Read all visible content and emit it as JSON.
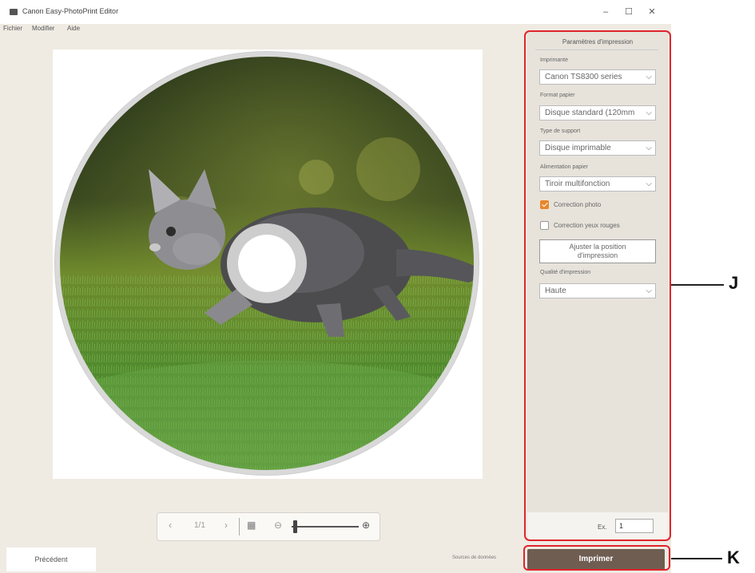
{
  "window": {
    "title": "Canon Easy-PhotoPrint Editor",
    "controls": {
      "minimize": "–",
      "maximize": "☐",
      "close": "✕"
    }
  },
  "menu": [
    "Fichier",
    "Modifier",
    "Aide"
  ],
  "panel": {
    "title": "Paramètres d'impression",
    "printer_label": "Imprimante",
    "printer_value": "Canon TS8300 series",
    "paper_size_label": "Format papier",
    "paper_size_value": "Disque standard (120mm",
    "media_type_label": "Type de support",
    "media_type_value": "Disque imprimable",
    "paper_source_label": "Alimentation papier",
    "paper_source_value": "Tiroir multifonction",
    "photo_fix_label": "Correction photo",
    "photo_fix_checked": true,
    "red_eye_label": "Correction yeux rouges",
    "red_eye_checked": false,
    "adjust_button_line1": "Ajuster la position",
    "adjust_button_line2": "d'impression",
    "quality_label": "Qualité d'impression",
    "quality_value": "Haute",
    "copies_label": "Ex.",
    "copies_value": "1"
  },
  "zoombar": {
    "prev_icon": "‹",
    "page": "1/1",
    "next_icon": "›",
    "grid_icon": "▦",
    "zoom_out_icon": "⊖",
    "zoom_in_icon": "⊕",
    "zoom_level": 0.05
  },
  "bottom": {
    "previous_label": "Précédent",
    "note": "Sources de données",
    "print_label": "Imprimer"
  },
  "callouts": {
    "j": "J",
    "k": "K"
  },
  "colors": {
    "accent": "#e0242a",
    "print_button": "#6f5d52",
    "checkbox_on": "#e8862a"
  }
}
